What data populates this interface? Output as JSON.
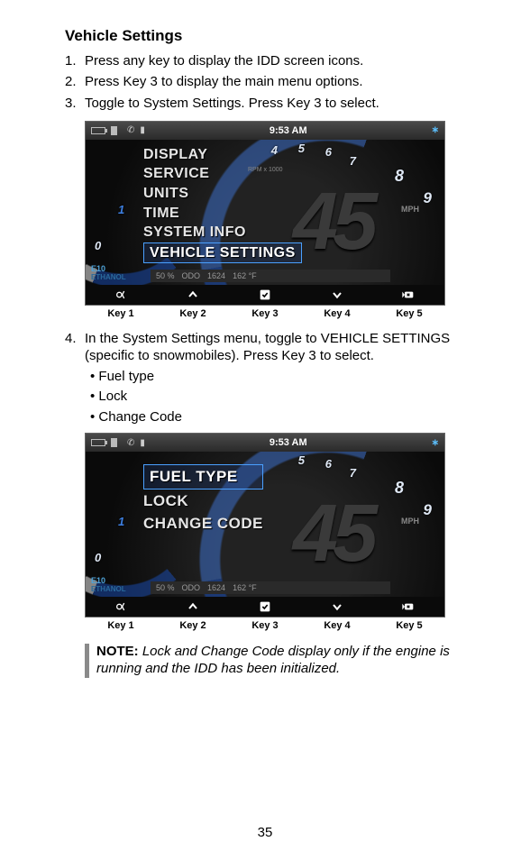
{
  "heading": "Vehicle Settings",
  "steps": {
    "s1": "Press any key to display the IDD screen icons.",
    "s2": "Press Key 3 to display the main menu options.",
    "s3": "Toggle to System Settings. Press Key 3 to select.",
    "s4": "In the System Settings menu, toggle to VEHICLE SETTINGS (specific to snowmobiles). Press Key 3 to select."
  },
  "bullets": {
    "b1": "Fuel type",
    "b2": "Lock",
    "b3": "Change Code"
  },
  "screen1": {
    "clock": "9:53 AM",
    "menu": {
      "display": "DISPLAY",
      "service": "SERVICE",
      "units": "UNITS",
      "time": "TIME",
      "sysinfo": "SYSTEM INFO",
      "vehicle": "VEHICLE SETTINGS"
    },
    "ticks": {
      "t0": "0",
      "t1": "1",
      "t4": "4",
      "t5": "5",
      "t6": "6",
      "t7": "7",
      "t8": "8",
      "t9": "9"
    },
    "big": "45",
    "mph": "MPH",
    "rpm": "RPM x 1000",
    "fuel_line1": "E10",
    "fuel_line2": "ETHANOL",
    "readout": {
      "r1": "50 %",
      "r2": "ODO",
      "r3": "1624",
      "r4": "162 °F"
    }
  },
  "screen2": {
    "clock": "9:53 AM",
    "menu": {
      "fuel": "FUEL TYPE",
      "lock": "LOCK",
      "change": "CHANGE CODE"
    },
    "ticks": {
      "t0": "0",
      "t1": "1",
      "t5": "5",
      "t6": "6",
      "t7": "7",
      "t8": "8",
      "t9": "9"
    },
    "big": "45",
    "mph": "MPH",
    "fuel_line1": "E10",
    "fuel_line2": "ETHANOL",
    "readout": {
      "r1": "50 %",
      "r2": "ODO",
      "r3": "1624",
      "r4": "162 °F"
    }
  },
  "keylabels": {
    "k1": "Key 1",
    "k2": "Key 2",
    "k3": "Key 3",
    "k4": "Key 4",
    "k5": "Key 5"
  },
  "note": {
    "label": "NOTE:",
    "text": " Lock and Change Code display only if the engine is running and the IDD has been initialized."
  },
  "page": "35"
}
